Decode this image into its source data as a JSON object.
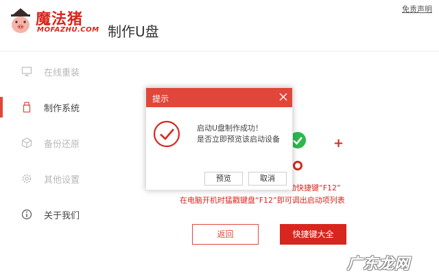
{
  "app": {
    "logo_cn": "魔法猪",
    "logo_en": "MOFAZHU.COM",
    "title": "制作U盘",
    "disclaimer": "免责声明"
  },
  "sidebar": {
    "items": [
      {
        "label": "在线重装",
        "icon": "monitor-icon",
        "active": false
      },
      {
        "label": "制作系统",
        "icon": "usb-icon",
        "active": true
      },
      {
        "label": "备份还原",
        "icon": "cube-icon",
        "active": false
      },
      {
        "label": "其他设置",
        "icon": "gear-icon",
        "active": false
      },
      {
        "label": "关于我们",
        "icon": "info-icon",
        "active": false
      }
    ]
  },
  "main": {
    "hint_line1": "动快捷键“F12”",
    "hint_line2": "在电脑开机时猛戳键盘“F12”即可调出启动项列表",
    "back_label": "返回",
    "shortcuts_label": "快捷键大全"
  },
  "dialog": {
    "title": "提示",
    "message_line1": "启动U盘制作成功！",
    "message_line2": "是否立即预览该启动设备",
    "preview_label": "预览",
    "cancel_label": "取消"
  },
  "watermark": "广东龙网",
  "colors": {
    "accent": "#e0463a",
    "brand_red": "#d7261e",
    "success_green": "#2db84d"
  }
}
